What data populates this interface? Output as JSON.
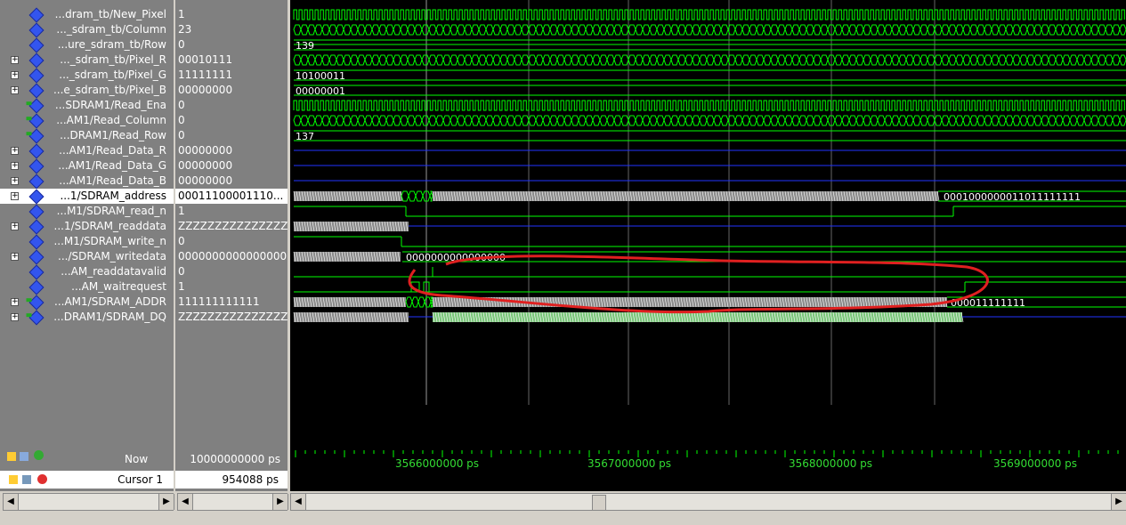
{
  "signals": [
    {
      "name": "...dram_tb/New_Pixel",
      "value": "1",
      "expand": false,
      "icon": "diamond"
    },
    {
      "name": "..._sdram_tb/Column",
      "value": "23",
      "expand": false,
      "icon": "diamond"
    },
    {
      "name": "...ure_sdram_tb/Row",
      "value": "0",
      "expand": false,
      "icon": "diamond"
    },
    {
      "name": "..._sdram_tb/Pixel_R",
      "value": "00010111",
      "expand": true,
      "icon": "diamond"
    },
    {
      "name": "..._sdram_tb/Pixel_G",
      "value": "11111111",
      "expand": true,
      "icon": "diamond"
    },
    {
      "name": "...e_sdram_tb/Pixel_B",
      "value": "00000000",
      "expand": true,
      "icon": "diamond"
    },
    {
      "name": "...SDRAM1/Read_Ena",
      "value": "0",
      "expand": false,
      "icon": "diamond-arrow"
    },
    {
      "name": "...AM1/Read_Column",
      "value": "0",
      "expand": false,
      "icon": "diamond-arrow"
    },
    {
      "name": "...DRAM1/Read_Row",
      "value": "0",
      "expand": false,
      "icon": "diamond-arrow"
    },
    {
      "name": "...AM1/Read_Data_R",
      "value": "00000000",
      "expand": true,
      "icon": "diamond"
    },
    {
      "name": "...AM1/Read_Data_G",
      "value": "00000000",
      "expand": true,
      "icon": "diamond"
    },
    {
      "name": "...AM1/Read_Data_B",
      "value": "00000000",
      "expand": true,
      "icon": "diamond"
    },
    {
      "name": "...1/SDRAM_address",
      "value": "00011100001110...",
      "expand": true,
      "icon": "diamond",
      "selected": true
    },
    {
      "name": "...M1/SDRAM_read_n",
      "value": "1",
      "expand": false,
      "icon": "diamond"
    },
    {
      "name": "...1/SDRAM_readdata",
      "value": "ZZZZZZZZZZZZZZZZ",
      "expand": true,
      "icon": "diamond"
    },
    {
      "name": "...M1/SDRAM_write_n",
      "value": "0",
      "expand": false,
      "icon": "diamond"
    },
    {
      "name": ".../SDRAM_writedata",
      "value": "0000000000000000",
      "expand": true,
      "icon": "diamond"
    },
    {
      "name": "...AM_readdatavalid",
      "value": "0",
      "expand": false,
      "icon": "diamond"
    },
    {
      "name": "...AM_waitrequest",
      "value": "1",
      "expand": false,
      "icon": "diamond"
    },
    {
      "name": "...AM1/SDRAM_ADDR",
      "value": "111111111111",
      "expand": true,
      "icon": "diamond-arrow"
    },
    {
      "name": "...DRAM1/SDRAM_DQ",
      "value": "ZZZZZZZZZZZZZZZZ",
      "expand": true,
      "icon": "diamond-arrow"
    }
  ],
  "wave_labels": {
    "row": "139",
    "pixel_g": "10100011",
    "pixel_b": "00000001",
    "read_row": "137",
    "sdram_address_end": "0001000000011011111111",
    "writedata": "0000000000000000",
    "sdram_addr_end": "000011111111"
  },
  "footer": {
    "now_label": "Now",
    "now_value": "10000000000 ps",
    "cursor_label": "Cursor 1",
    "cursor_value": "954088 ps",
    "ticks": [
      "3566000000 ps",
      "3567000000 ps",
      "3568000000 ps",
      "3569000000 ps"
    ]
  },
  "colors": {
    "wave_green": "#00ff00",
    "bus_blue": "#2233ff",
    "annotation_red": "#e02020",
    "panel_gray": "#808080"
  }
}
